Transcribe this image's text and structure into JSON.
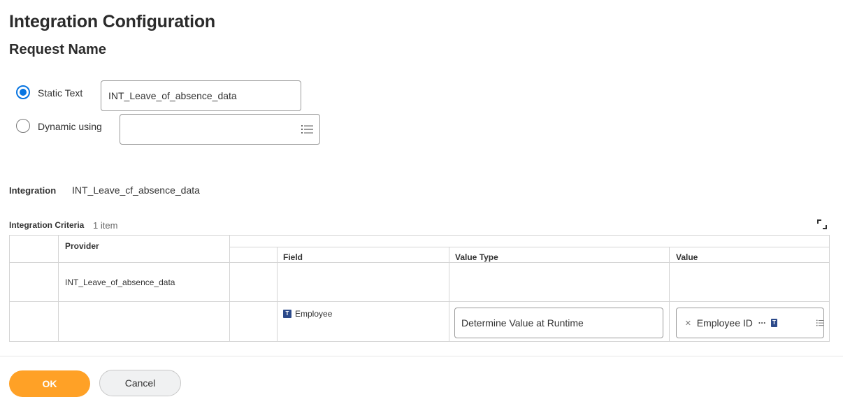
{
  "page": {
    "title": "Integration Configuration",
    "section_title": "Request Name"
  },
  "request_name": {
    "static_text_label": "Static Text",
    "static_text_value": "INT_Leave_of_absence_data",
    "dynamic_label": "Dynamic using",
    "dynamic_value": "",
    "selected_option": "Static Text"
  },
  "integration": {
    "label": "Integration",
    "value": "INT_Leave_cf_absence_data"
  },
  "criteria": {
    "label": "Integration Criteria",
    "count": "1 item",
    "columns": {
      "provider": "Provider",
      "field": "Field",
      "value_type": "Value Type",
      "value": "Value"
    },
    "rows": [
      {
        "provider": "INT_Leave_of_absence_data",
        "field": "Employee",
        "value_type": "Determine Value at Runtime",
        "value": "Employee ID"
      }
    ]
  },
  "icons": {
    "prompt": "prompt-list-icon",
    "expand": "expand-icon",
    "clear": "clear-x-icon",
    "more": "more-dots-icon",
    "type_badge": "T"
  },
  "colors": {
    "accent_blue": "#0875e1",
    "ok_orange": "#ffa126",
    "badge_navy": "#2c4a8a"
  },
  "footer": {
    "ok_label": "OK",
    "cancel_label": "Cancel"
  }
}
